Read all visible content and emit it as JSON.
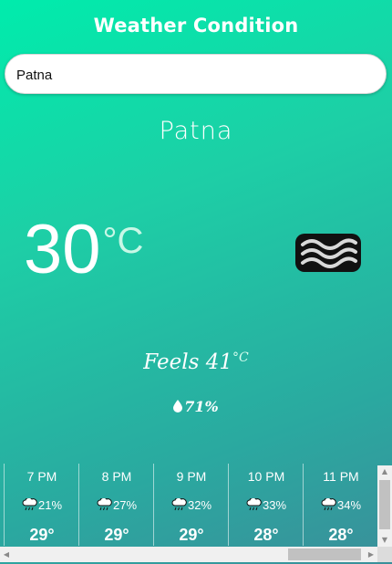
{
  "app": {
    "title": "Weather Condition"
  },
  "search": {
    "value": "Patna",
    "placeholder": ""
  },
  "current": {
    "city": "Patna",
    "temperature": "30",
    "unit": "°C",
    "condition_icon": "haze-waves-icon",
    "feels_like_text": "Feels 41",
    "feels_like_unit": "°C",
    "humidity": "71%"
  },
  "hourly": [
    {
      "time": "7 PM",
      "rain": "21%",
      "temp": "29°",
      "icon": "rain-cloud-icon"
    },
    {
      "time": "8 PM",
      "rain": "27%",
      "temp": "29°",
      "icon": "rain-cloud-icon"
    },
    {
      "time": "9 PM",
      "rain": "32%",
      "temp": "29°",
      "icon": "rain-cloud-icon"
    },
    {
      "time": "10 PM",
      "rain": "33%",
      "temp": "28°",
      "icon": "rain-cloud-icon"
    },
    {
      "time": "11 PM",
      "rain": "34%",
      "temp": "28°",
      "icon": "rain-cloud-icon"
    }
  ],
  "colors": {
    "gradient_start": "#00ecac",
    "gradient_end": "#3a8f9a",
    "text": "#ffffff"
  }
}
